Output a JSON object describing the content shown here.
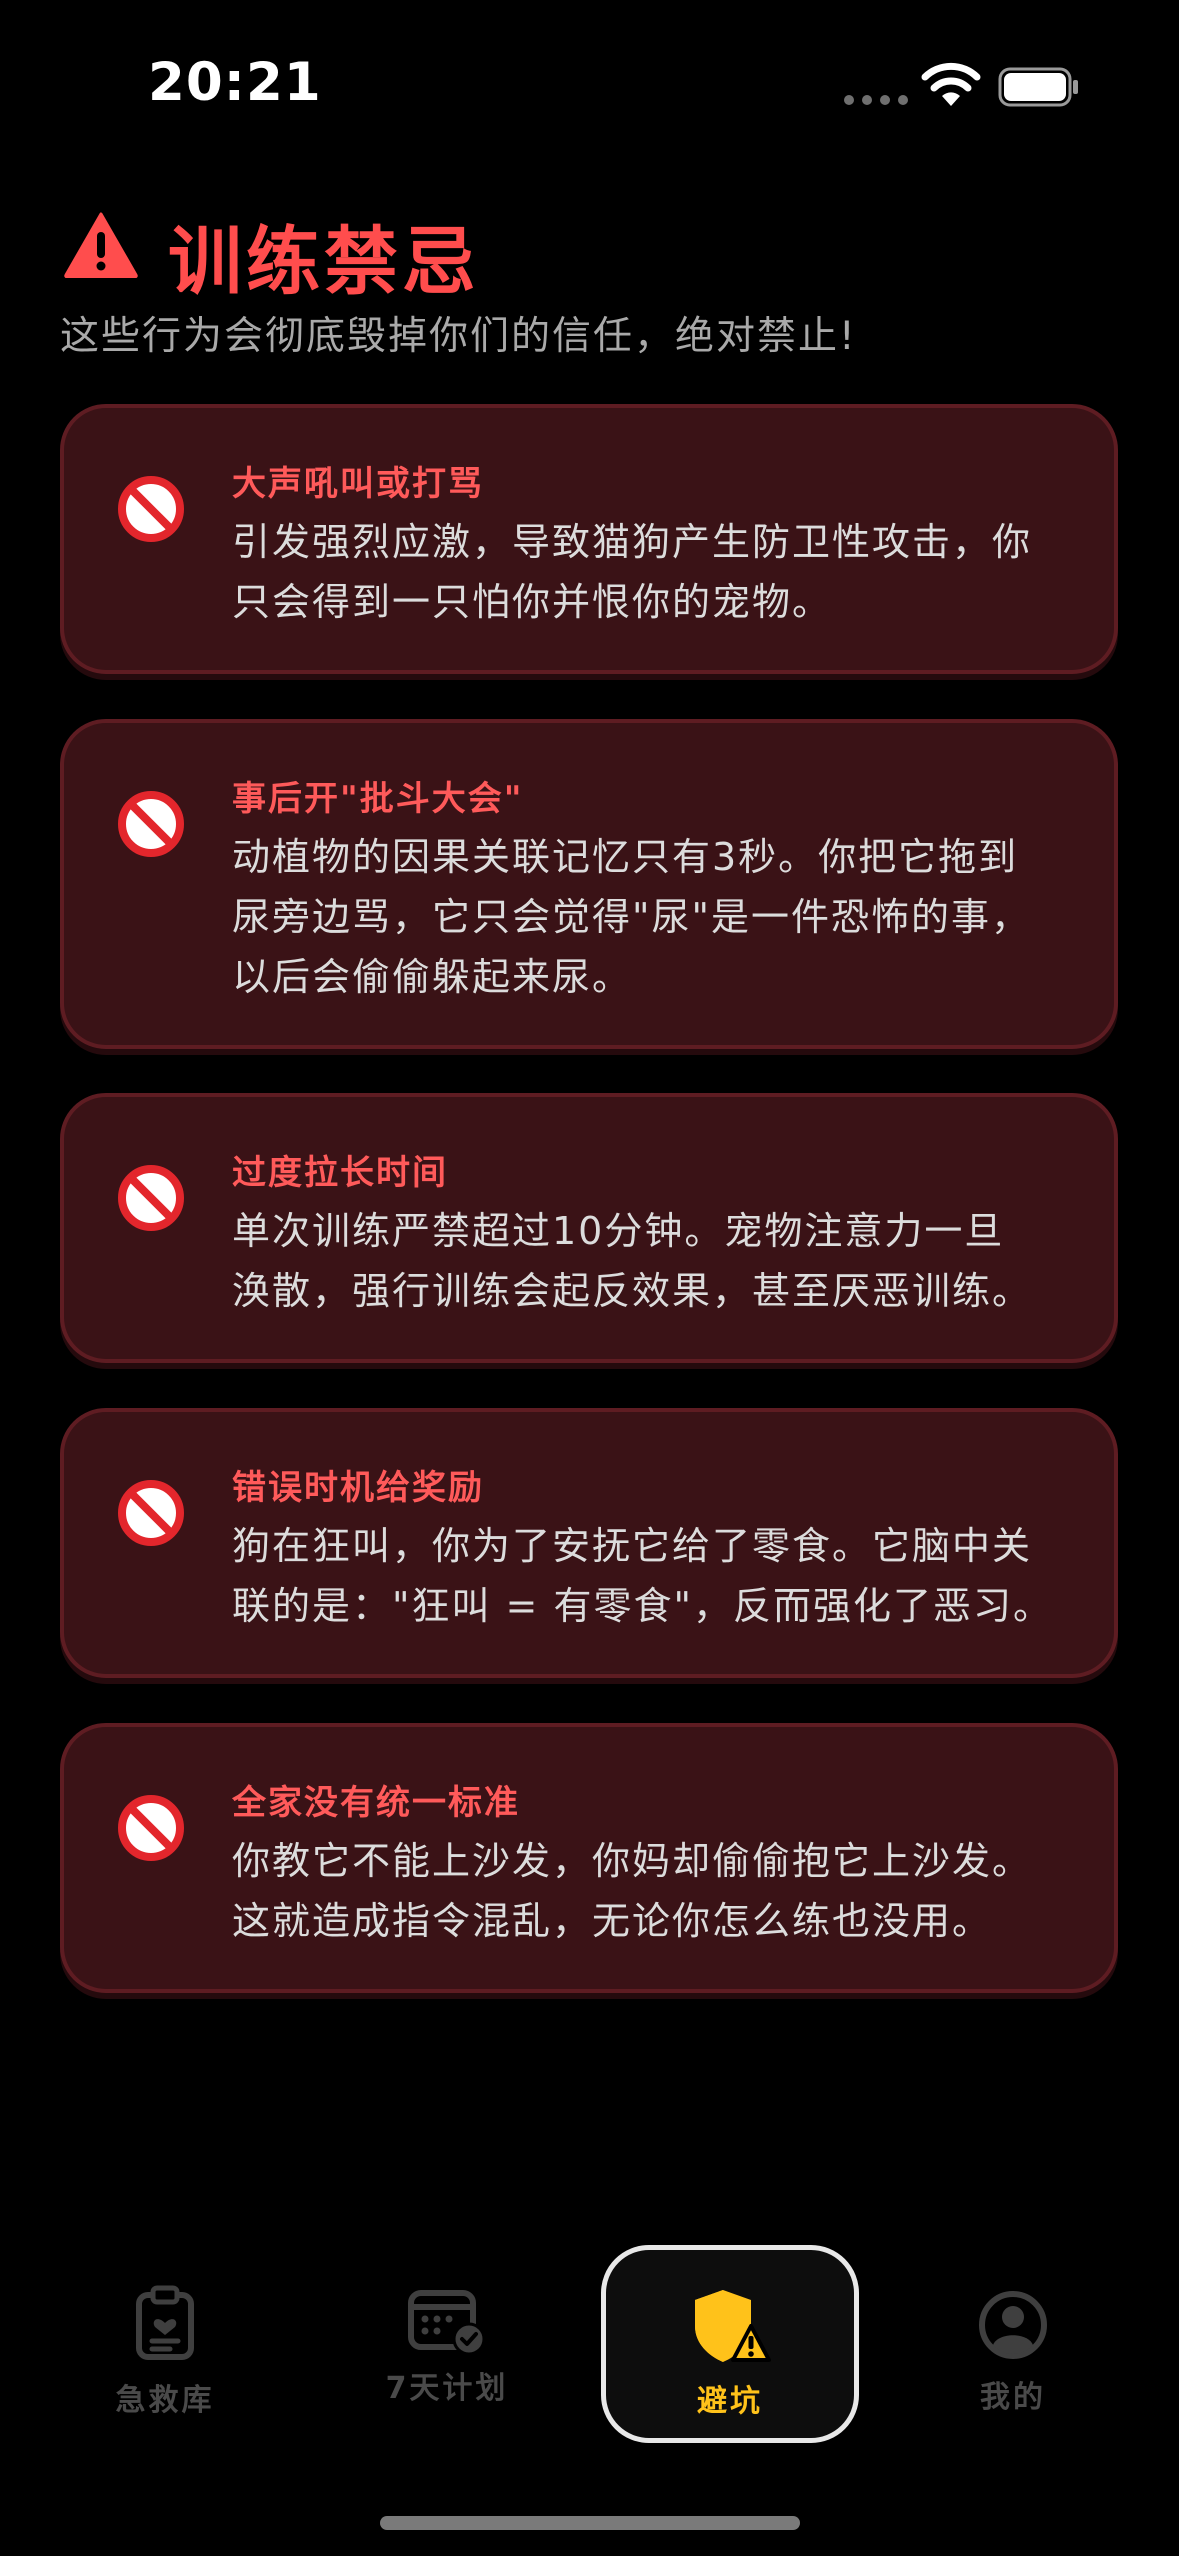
{
  "status_bar": {
    "time": "20:21"
  },
  "header": {
    "title": "训练禁忌",
    "subtitle": "这些行为会彻底毁掉你们的信任，绝对禁止!",
    "title_color": "#ff4d4d"
  },
  "taboos": [
    {
      "icon": "prohibited-icon",
      "title": "大声吼叫或打骂",
      "lines": [
        "引发强烈应激，导致猫狗产生防卫性攻击，你",
        "只会得到一只怕你并恨你的宠物。"
      ]
    },
    {
      "icon": "prohibited-icon",
      "title": "事后开\"批斗大会\"",
      "lines": [
        "动植物的因果关联记忆只有3秒。你把它拖到",
        "尿旁边骂，它只会觉得\"尿\"是一件恐怖的事，",
        "以后会偷偷躲起来尿。"
      ]
    },
    {
      "icon": "prohibited-icon",
      "title": "过度拉长时间",
      "lines": [
        "单次训练严禁超过10分钟。宠物注意力一旦",
        "涣散，强行训练会起反效果，甚至厌恶训练。"
      ]
    },
    {
      "icon": "prohibited-icon",
      "title": "错误时机给奖励",
      "lines": [
        "狗在狂叫，你为了安抚它给了零食。它脑中关",
        "联的是：\"狂叫 = 有零食\"，反而强化了恶习。"
      ]
    },
    {
      "icon": "prohibited-icon",
      "title": "全家没有统一标准",
      "lines": [
        "你教它不能上沙发，你妈却偷偷抱它上沙发。",
        "这就造成指令混乱，无论你怎么练也没用。"
      ]
    }
  ],
  "tab_bar": {
    "tabs": [
      {
        "label": "急救库",
        "icon": "clipboard-heart-icon",
        "active": false
      },
      {
        "label": "7天计划",
        "icon": "calendar-check-icon",
        "active": false
      },
      {
        "label": "避坑",
        "icon": "shield-warning-icon",
        "active": true
      },
      {
        "label": "我的",
        "icon": "person-circle-icon",
        "active": false
      }
    ],
    "active_color": "#ffc21a",
    "inactive_color": "#4a4a4a"
  },
  "colors": {
    "card_background": "#3a1216",
    "card_border": "#5e1c22",
    "card_title": "#ff5a5a",
    "card_body": "#dcdcdc"
  }
}
